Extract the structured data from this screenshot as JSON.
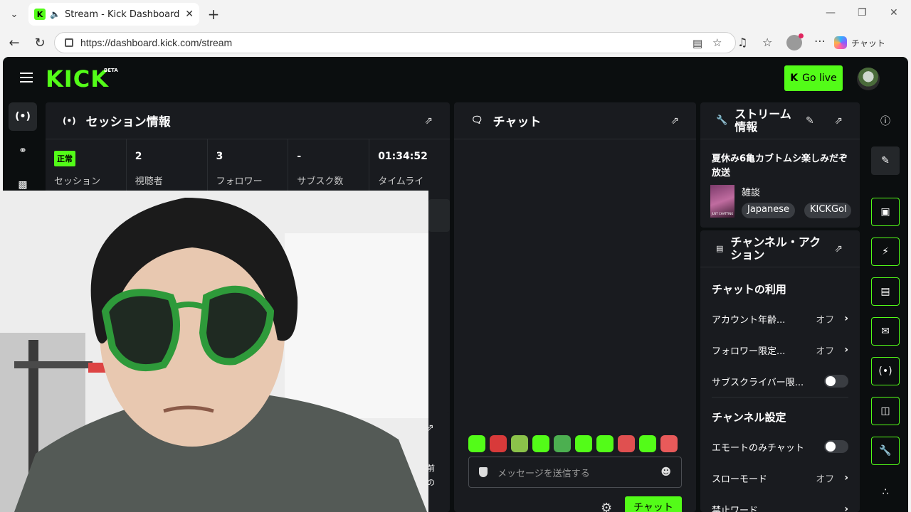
{
  "browser": {
    "tab_title": "Stream - Kick Dashboard",
    "url": "https://dashboard.kick.com/stream",
    "copilot_label": "チャット"
  },
  "header": {
    "logo": "KICK",
    "beta": "BETA",
    "go_live": "Go live"
  },
  "session": {
    "title": "セッション情報",
    "stats": [
      {
        "value": "正常",
        "label": "セッション"
      },
      {
        "value": "2",
        "label": "視聴者"
      },
      {
        "value": "3",
        "label": "フォロワー"
      },
      {
        "value": "-",
        "label": "サブスク数"
      },
      {
        "value": "01:34:52",
        "label": "タイムライ"
      }
    ],
    "partial_texts": [
      "前",
      "の"
    ]
  },
  "chat": {
    "title": "チャット",
    "placeholder": "メッセージを送信する",
    "send_label": "チャット",
    "emote_colors": [
      "#53fc18",
      "#d83a3a",
      "#8bc34a",
      "#53fc18",
      "#4caf50",
      "#53fc18",
      "#53fc18",
      "#e05050",
      "#53fc18",
      "#e85a5a"
    ]
  },
  "stream_info": {
    "title": "ストリーム情報",
    "stream_title": "夏休み6亀カブトムシ楽しみだぞ放送",
    "category": "雑談",
    "thumb_text": "JUST CHATTING",
    "tags": [
      "Japanese",
      "KICKGol"
    ]
  },
  "channel_actions": {
    "title": "チャンネル・アクション",
    "chat_usage_heading": "チャットの利用",
    "rows_chat": [
      {
        "label": "アカウント年齢...",
        "value": "オフ",
        "kind": "chevron"
      },
      {
        "label": "フォロワー限定...",
        "value": "オフ",
        "kind": "chevron"
      },
      {
        "label": "サブスクライバー限...",
        "value": "",
        "kind": "toggle"
      }
    ],
    "channel_settings_heading": "チャンネル設定",
    "rows_channel": [
      {
        "label": "エモートのみチャット",
        "value": "",
        "kind": "toggle"
      },
      {
        "label": "スローモード",
        "value": "オフ",
        "kind": "chevron"
      },
      {
        "label": "禁止ワード",
        "value": "",
        "kind": "chevron"
      }
    ]
  }
}
